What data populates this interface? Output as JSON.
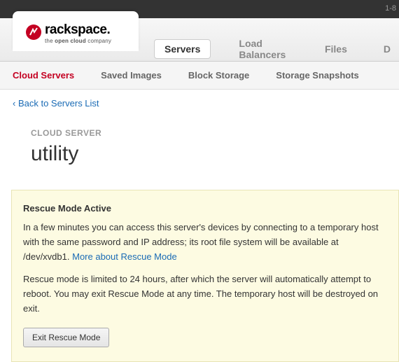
{
  "topbar": {
    "phone_prefix": "1-8"
  },
  "brand": {
    "name": "rackspace.",
    "tagline_pre": "the ",
    "tagline_bold": "open cloud",
    "tagline_post": " company"
  },
  "main_nav": [
    {
      "label": "Servers",
      "active": true
    },
    {
      "label": "Load Balancers",
      "active": false
    },
    {
      "label": "Files",
      "active": false
    },
    {
      "label": "D",
      "active": false
    }
  ],
  "sub_nav": [
    {
      "label": "Cloud Servers",
      "active": true
    },
    {
      "label": "Saved Images",
      "active": false
    },
    {
      "label": "Block Storage",
      "active": false
    },
    {
      "label": "Storage Snapshots",
      "active": false
    }
  ],
  "back_link": "‹ Back to Servers List",
  "section_label": "CLOUD SERVER",
  "server_name": "utility",
  "notice": {
    "title": "Rescue Mode Active",
    "para1": "In a few minutes you can access this server's devices by connecting to a temporary host with the same password and IP address; its root file system will be available at /dev/xvdb1. ",
    "more_link": "More about Rescue Mode",
    "para2": "Rescue mode is limited to 24 hours, after which the server will automatically attempt to reboot. You may exit Rescue Mode at any time. The temporary host will be destroyed on exit.",
    "exit_button": "Exit Rescue Mode"
  }
}
